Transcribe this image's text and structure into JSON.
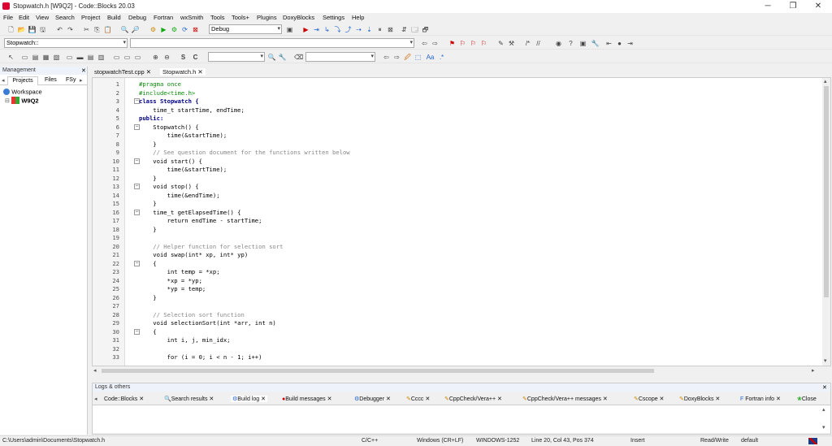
{
  "window": {
    "title": "Stopwatch.h [W9Q2] - Code::Blocks 20.03"
  },
  "menu": [
    "File",
    "Edit",
    "View",
    "Search",
    "Project",
    "Build",
    "Debug",
    "Fortran",
    "wxSmith",
    "Tools",
    "Tools+",
    "Plugins",
    "DoxyBlocks",
    "Settings",
    "Help"
  ],
  "toolbar": {
    "build_target": "Debug",
    "scope_combo": "Stopwatch::",
    "search_combo": "",
    "find_combo": ""
  },
  "management": {
    "title": "Management",
    "tabs": [
      "Projects",
      "Files",
      "FSy"
    ],
    "tree": {
      "root": "Workspace",
      "project": "W9Q2"
    }
  },
  "editor": {
    "tabs": [
      {
        "label": "stopwatchTest.cpp"
      },
      {
        "label": "Stopwatch.h"
      }
    ],
    "lines": [
      "#pragma once",
      "#include<time.h>",
      "class Stopwatch {",
      "    time_t startTime, endTime;",
      "public:",
      "    Stopwatch() {",
      "        time(&startTime);",
      "    }",
      "    // See question document for the functions written below",
      "    void start() {",
      "        time(&startTime);",
      "    }",
      "    void stop() {",
      "        time(&endTime);",
      "    }",
      "    time_t getElapsedTime() {",
      "        return endTime - startTime;",
      "    }",
      "",
      "    // Helper function for selection sort",
      "    void swap(int* xp, int* yp)",
      "    {",
      "        int temp = *xp;",
      "        *xp = *yp;",
      "        *yp = temp;",
      "    }",
      "",
      "    // Selection sort function",
      "    void selectionSort(int *arr, int n)",
      "    {",
      "        int i, j, min_idx;",
      "",
      "        for (i = 0; i < n - 1; i++)"
    ]
  },
  "logs": {
    "title": "Logs & others",
    "tabs": [
      "Code::Blocks",
      "Search results",
      "Build log",
      "Build messages",
      "Debugger",
      "Cccc",
      "CppCheck/Vera++",
      "CppCheck/Vera++ messages",
      "Cscope",
      "DoxyBlocks",
      "Fortran info",
      "Close"
    ]
  },
  "status": {
    "path": "C:\\Users\\admin\\Documents\\Stopwatch.h",
    "lang": "C/C++",
    "eol": "Windows (CR+LF)",
    "encoding": "WINDOWS-1252",
    "position": "Line 20, Col 43, Pos 374",
    "mode": "Insert",
    "access": "Read/Write",
    "profile": "default"
  }
}
